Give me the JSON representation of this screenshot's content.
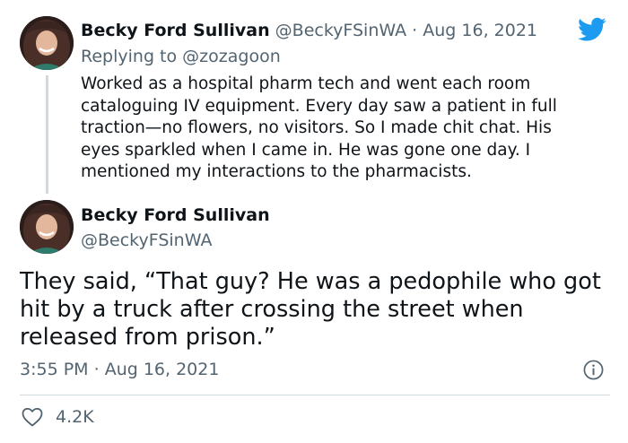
{
  "reply_tweet": {
    "author_name": "Becky Ford Sullivan",
    "author_handle": "@BeckyFSinWA",
    "separator": "·",
    "date": "Aug 16, 2021",
    "replying_prefix": "Replying to",
    "replying_to": "@zozagoon",
    "text": "Worked as a hospital pharm tech and went each room cataloguing IV equipment. Every day saw a patient in full traction—no flowers, no visitors. So I made chit chat. His eyes sparkled when I came in. He was gone one day. I mentioned my interactions to the pharmacists."
  },
  "main_tweet": {
    "author_name": "Becky Ford Sullivan",
    "author_handle": "@BeckyFSinWA",
    "text": "They said, “That guy? He was a pedophile who got hit by a truck after crossing the street when released from prison.”",
    "time": "3:55 PM",
    "separator": "·",
    "date": "Aug 16, 2021",
    "likes": "4.2K"
  },
  "icons": {
    "brand": "twitter-bird-icon",
    "info": "info-icon",
    "like": "heart-icon"
  },
  "colors": {
    "brand_blue": "#1d9bf0",
    "text_primary": "#0f1419",
    "text_secondary": "#536471",
    "divider": "#cfd9de"
  }
}
